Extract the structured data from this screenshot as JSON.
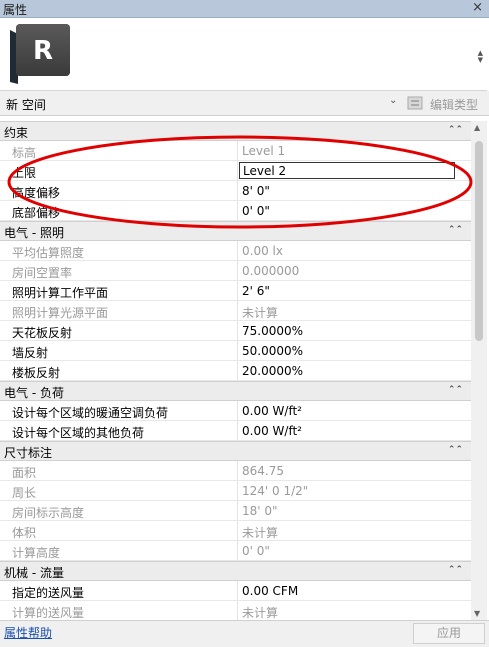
{
  "panel": {
    "title": "属性",
    "close_glyph": "×"
  },
  "type_area": {
    "icon": "revit-r-icon",
    "icon_letter": "R"
  },
  "type_selector": {
    "name": "新 空间",
    "edit_type_label": "编辑类型"
  },
  "groups": [
    {
      "title": "约束",
      "rows": [
        {
          "name": "标高",
          "value": "Level 1",
          "disabled": true
        },
        {
          "name": "上限",
          "value": "Level 2",
          "editing": true
        },
        {
          "name": "高度偏移",
          "value": "8'  0\""
        },
        {
          "name": "底部偏移",
          "value": "0'  0\""
        }
      ]
    },
    {
      "title": "电气 - 照明",
      "rows": [
        {
          "name": "平均估算照度",
          "value": "0.00 lx",
          "disabled": true
        },
        {
          "name": "房间空置率",
          "value": "0.000000",
          "disabled": true
        },
        {
          "name": "照明计算工作平面",
          "value": "2'  6\""
        },
        {
          "name": "照明计算光源平面",
          "value": "未计算",
          "disabled": true
        },
        {
          "name": "天花板反射",
          "value": "75.0000%"
        },
        {
          "name": "墙反射",
          "value": "50.0000%"
        },
        {
          "name": "楼板反射",
          "value": "20.0000%"
        }
      ]
    },
    {
      "title": "电气 - 负荷",
      "rows": [
        {
          "name": "设计每个区域的暖通空调负荷",
          "value": "0.00 W/ft²"
        },
        {
          "name": "设计每个区域的其他负荷",
          "value": "0.00 W/ft²"
        }
      ]
    },
    {
      "title": "尺寸标注",
      "rows": [
        {
          "name": "面积",
          "value": "864.75",
          "disabled": true
        },
        {
          "name": "周长",
          "value": "124'  0 1/2\"",
          "disabled": true
        },
        {
          "name": "房间标示高度",
          "value": "18'  0\"",
          "disabled": true
        },
        {
          "name": "体积",
          "value": "未计算",
          "disabled": true
        },
        {
          "name": "计算高度",
          "value": "0'  0\"",
          "disabled": true
        }
      ]
    },
    {
      "title": "机械 - 流量",
      "rows": [
        {
          "name": "指定的送风量",
          "value": "0.00 CFM"
        },
        {
          "name": "计算的送风量",
          "value": "未计算",
          "disabled": true
        }
      ]
    }
  ],
  "footer": {
    "help_link": "属性帮助",
    "apply_label": "应用"
  },
  "colors": {
    "annotation_ellipse": "#e00000",
    "titlebar": "#b8c8da",
    "group_header": "#ececec"
  }
}
